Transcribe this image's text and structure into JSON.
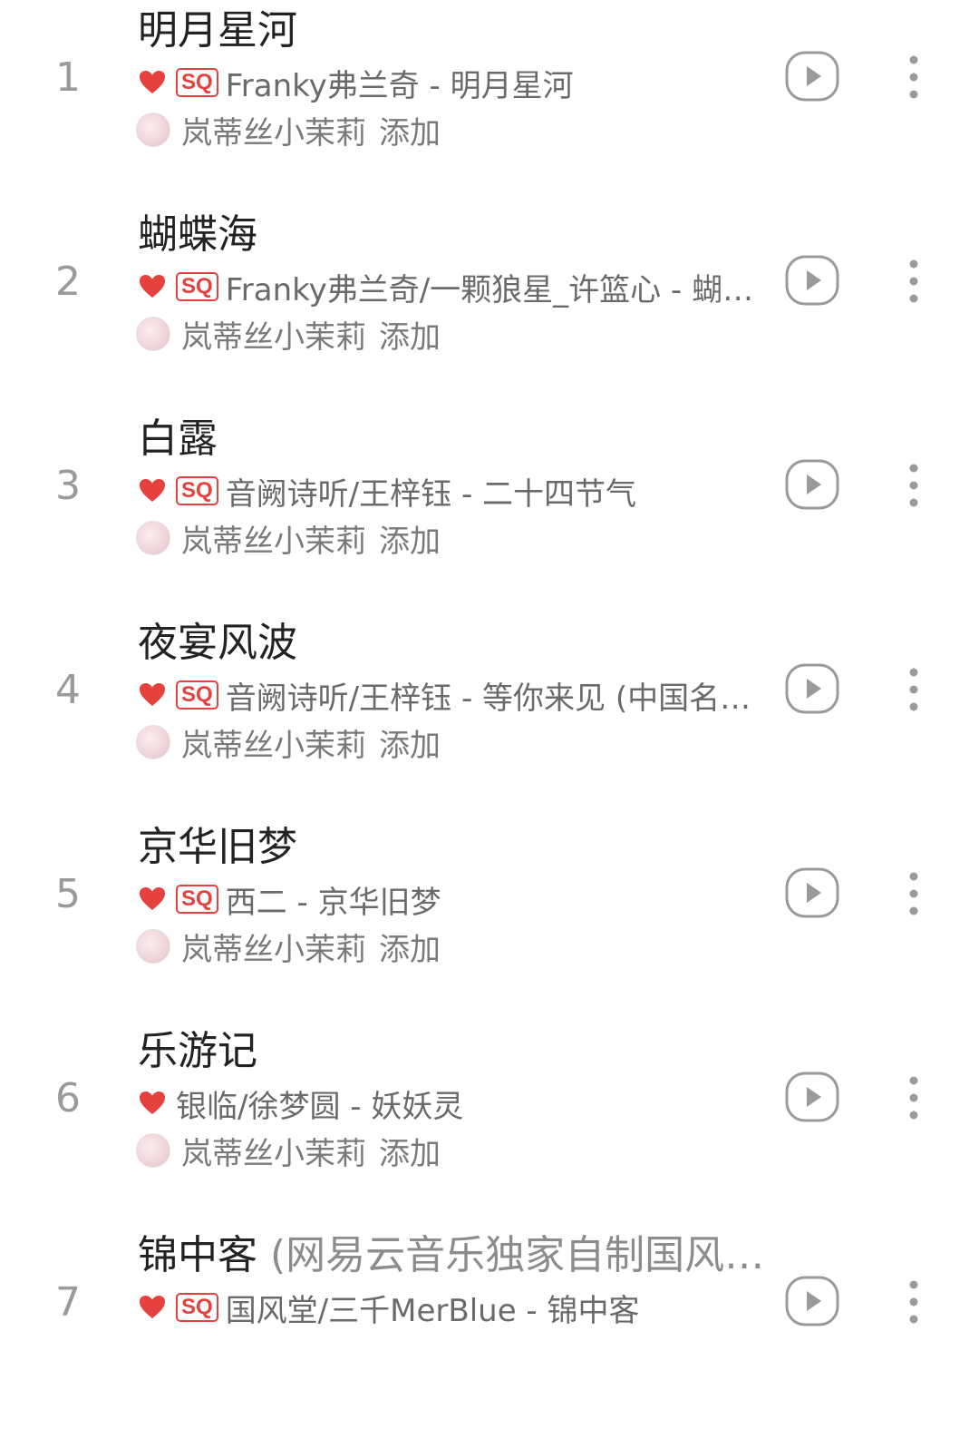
{
  "colors": {
    "accent_red": "#e5413e",
    "rank_gray": "#9a9a9a",
    "text_primary": "#222222",
    "text_secondary": "#6a6a6a"
  },
  "icons": {
    "liked": "heart-icon",
    "play": "play-circle-icon",
    "more": "more-vertical-icon",
    "quality": "sq-badge"
  },
  "songs": [
    {
      "rank": "1",
      "title": "明月星河",
      "title_extra": "",
      "sq": "SQ",
      "artist_album": "Franky弗兰奇 - 明月星河",
      "added_by": "岚蒂丝小茉莉",
      "added_word": "添加"
    },
    {
      "rank": "2",
      "title": "蝴蝶海",
      "title_extra": "",
      "sq": "SQ",
      "artist_album": "Franky弗兰奇/一颗狼星_许篮心 - 蝴…",
      "added_by": "岚蒂丝小茉莉",
      "added_word": "添加"
    },
    {
      "rank": "3",
      "title": "白露",
      "title_extra": "",
      "sq": "SQ",
      "artist_album": "音阙诗听/王梓钰 - 二十四节气",
      "added_by": "岚蒂丝小茉莉",
      "added_word": "添加"
    },
    {
      "rank": "4",
      "title": "夜宴风波",
      "title_extra": "",
      "sq": "SQ",
      "artist_album": "音阙诗听/王梓钰 - 等你来见 (中国名…",
      "added_by": "岚蒂丝小茉莉",
      "added_word": "添加"
    },
    {
      "rank": "5",
      "title": "京华旧梦",
      "title_extra": "",
      "sq": "SQ",
      "artist_album": "西二 - 京华旧梦",
      "added_by": "岚蒂丝小茉莉",
      "added_word": "添加"
    },
    {
      "rank": "6",
      "title": "乐游记",
      "title_extra": "",
      "sq": "",
      "artist_album": "银临/徐梦圆 - 妖妖灵",
      "added_by": "岚蒂丝小茉莉",
      "added_word": "添加"
    },
    {
      "rank": "7",
      "title": "锦中客",
      "title_extra": " (网易云音乐独家自制国风…",
      "sq": "SQ",
      "artist_album": "国风堂/三千MerBlue - 锦中客",
      "added_by": "",
      "added_word": ""
    }
  ]
}
